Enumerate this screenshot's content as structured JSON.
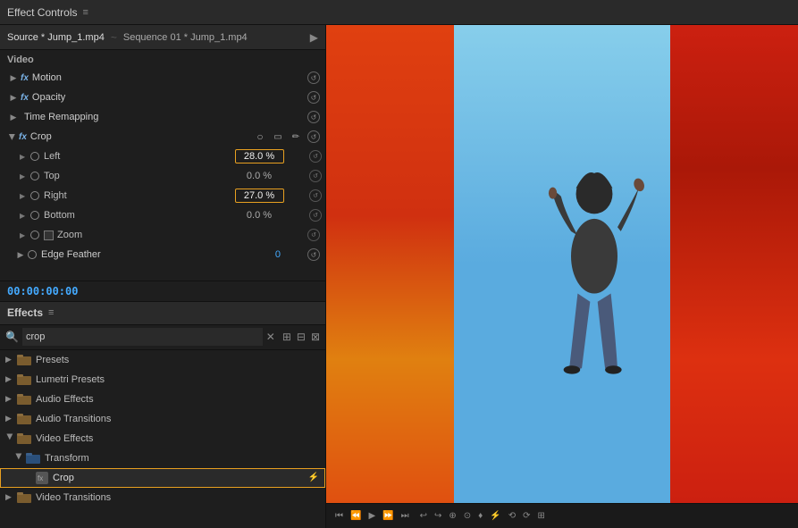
{
  "title_bar": {
    "label": "Effect Controls",
    "menu_icon": "≡"
  },
  "source_bar": {
    "tab1": "Source * Jump_1.mp4",
    "separator": "~",
    "tab2": "Sequence 01 * Jump_1.mp4",
    "arrow": "▶"
  },
  "effect_controls": {
    "video_label": "Video",
    "effects": [
      {
        "id": "motion",
        "name": "Motion",
        "has_fx": true,
        "expanded": false
      },
      {
        "id": "opacity",
        "name": "Opacity",
        "has_fx": true,
        "expanded": false
      },
      {
        "id": "time_remap",
        "name": "Time Remapping",
        "has_fx": false,
        "expanded": false
      },
      {
        "id": "crop",
        "name": "Crop",
        "has_fx": true,
        "expanded": true
      }
    ],
    "crop_params": [
      {
        "id": "left",
        "name": "Left",
        "value": "28.0 %",
        "highlighted": true
      },
      {
        "id": "top",
        "name": "Top",
        "value": "0.0 %",
        "highlighted": false
      },
      {
        "id": "right",
        "name": "Right",
        "value": "27.0 %",
        "highlighted": true
      },
      {
        "id": "bottom",
        "name": "Bottom",
        "value": "0.0 %",
        "highlighted": false
      }
    ],
    "zoom_label": "Zoom",
    "edge_feather": "Edge Feather",
    "edge_feather_value": "0"
  },
  "timecode": {
    "value": "00:00:00:00"
  },
  "effects_panel": {
    "title": "Effects",
    "menu_icon": "≡",
    "search_placeholder": "crop",
    "search_value": "crop",
    "tree_items": [
      {
        "id": "presets",
        "label": "Presets",
        "type": "folder",
        "color": "brown",
        "expanded": false,
        "indent": 0
      },
      {
        "id": "lumetri_presets",
        "label": "Lumetri Presets",
        "type": "folder",
        "color": "brown",
        "expanded": false,
        "indent": 0
      },
      {
        "id": "audio_effects",
        "label": "Audio Effects",
        "type": "folder",
        "color": "brown",
        "expanded": false,
        "indent": 0
      },
      {
        "id": "audio_transitions",
        "label": "Audio Transitions",
        "type": "folder",
        "color": "brown",
        "expanded": false,
        "indent": 0
      },
      {
        "id": "video_effects",
        "label": "Video Effects",
        "type": "folder",
        "color": "brown",
        "expanded": true,
        "indent": 0
      },
      {
        "id": "transform",
        "label": "Transform",
        "type": "folder",
        "color": "blue",
        "expanded": true,
        "indent": 1
      },
      {
        "id": "crop_effect",
        "label": "Crop",
        "type": "effect",
        "color": "gray",
        "expanded": false,
        "indent": 2,
        "selected": true,
        "has_accel": true
      },
      {
        "id": "video_transitions",
        "label": "Video Transitions",
        "type": "folder",
        "color": "brown",
        "expanded": false,
        "indent": 0
      }
    ]
  },
  "video_controls": {
    "buttons": [
      "◀◀",
      "◀",
      "●",
      "▶",
      "▶▶",
      "↩",
      "↪",
      "⊕",
      "⊙",
      "♦",
      "⚡",
      "⟲",
      "⟳",
      "⊞"
    ]
  }
}
